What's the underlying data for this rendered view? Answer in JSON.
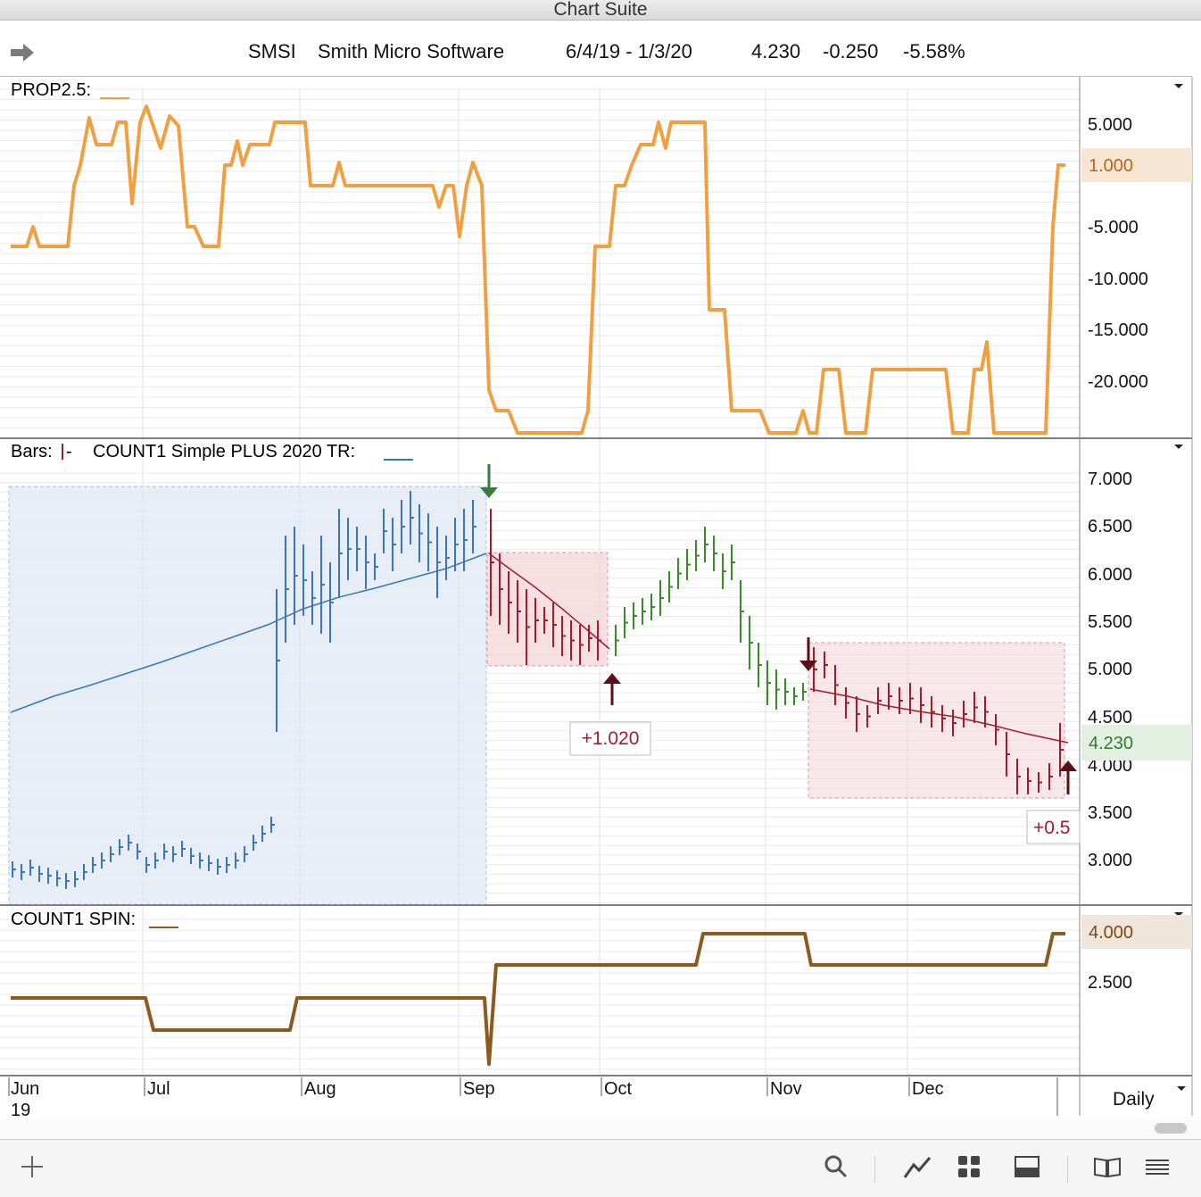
{
  "window": {
    "title": "Chart Suite"
  },
  "header": {
    "symbol": "SMSI",
    "company": "Smith Micro Software",
    "date_range": "6/4/19 - 1/3/20",
    "last": "4.230",
    "change": "-0.250",
    "change_pct": "-5.58%"
  },
  "panes": {
    "prop": {
      "label": "PROP2.5:",
      "ticks": [
        "5.000",
        "-5.000",
        "-10.000",
        "-15.000",
        "-20.000"
      ],
      "current_value": "1.000"
    },
    "price": {
      "label_bars": "Bars:",
      "label_indicator": "COUNT1 Simple PLUS 2020 TR:",
      "ticks": [
        "7.000",
        "6.500",
        "6.000",
        "5.500",
        "5.000",
        "4.500",
        "4.000",
        "3.500",
        "3.000"
      ],
      "current_value": "4.230",
      "trade_labels": [
        "+1.020",
        "+0.5"
      ]
    },
    "spin": {
      "label": "COUNT1 SPIN:",
      "ticks": [
        "2.500"
      ],
      "current_value": "4.000"
    }
  },
  "xaxis": {
    "months": [
      "Jun",
      "Jul",
      "Aug",
      "Sep",
      "Oct",
      "Nov",
      "Dec"
    ],
    "year": "19"
  },
  "period": "Daily",
  "colors": {
    "prop_line": "#f0a040",
    "spin_line": "#8b5a1e",
    "bars_history": "#3a78b5",
    "bars_up": "#3a8a2a",
    "bars_down": "#a01c30",
    "entry_arrow": "#3a7a40",
    "exit_arrow": "#5a1018",
    "trade_box": "#f3d5d8",
    "highlight_region": "#e8eef7"
  },
  "toolbar": {
    "icons": [
      "plus-icon",
      "search-icon",
      "line-chart-icon",
      "grid-icon",
      "panel-icon",
      "book-icon",
      "menu-icon"
    ]
  },
  "chart_data": {
    "type": "line",
    "x": [
      "Jun",
      "Jul",
      "Aug",
      "Sep",
      "Oct",
      "Nov",
      "Dec"
    ],
    "series": [],
    "ylim": [
      2.8,
      7.2
    ]
  }
}
